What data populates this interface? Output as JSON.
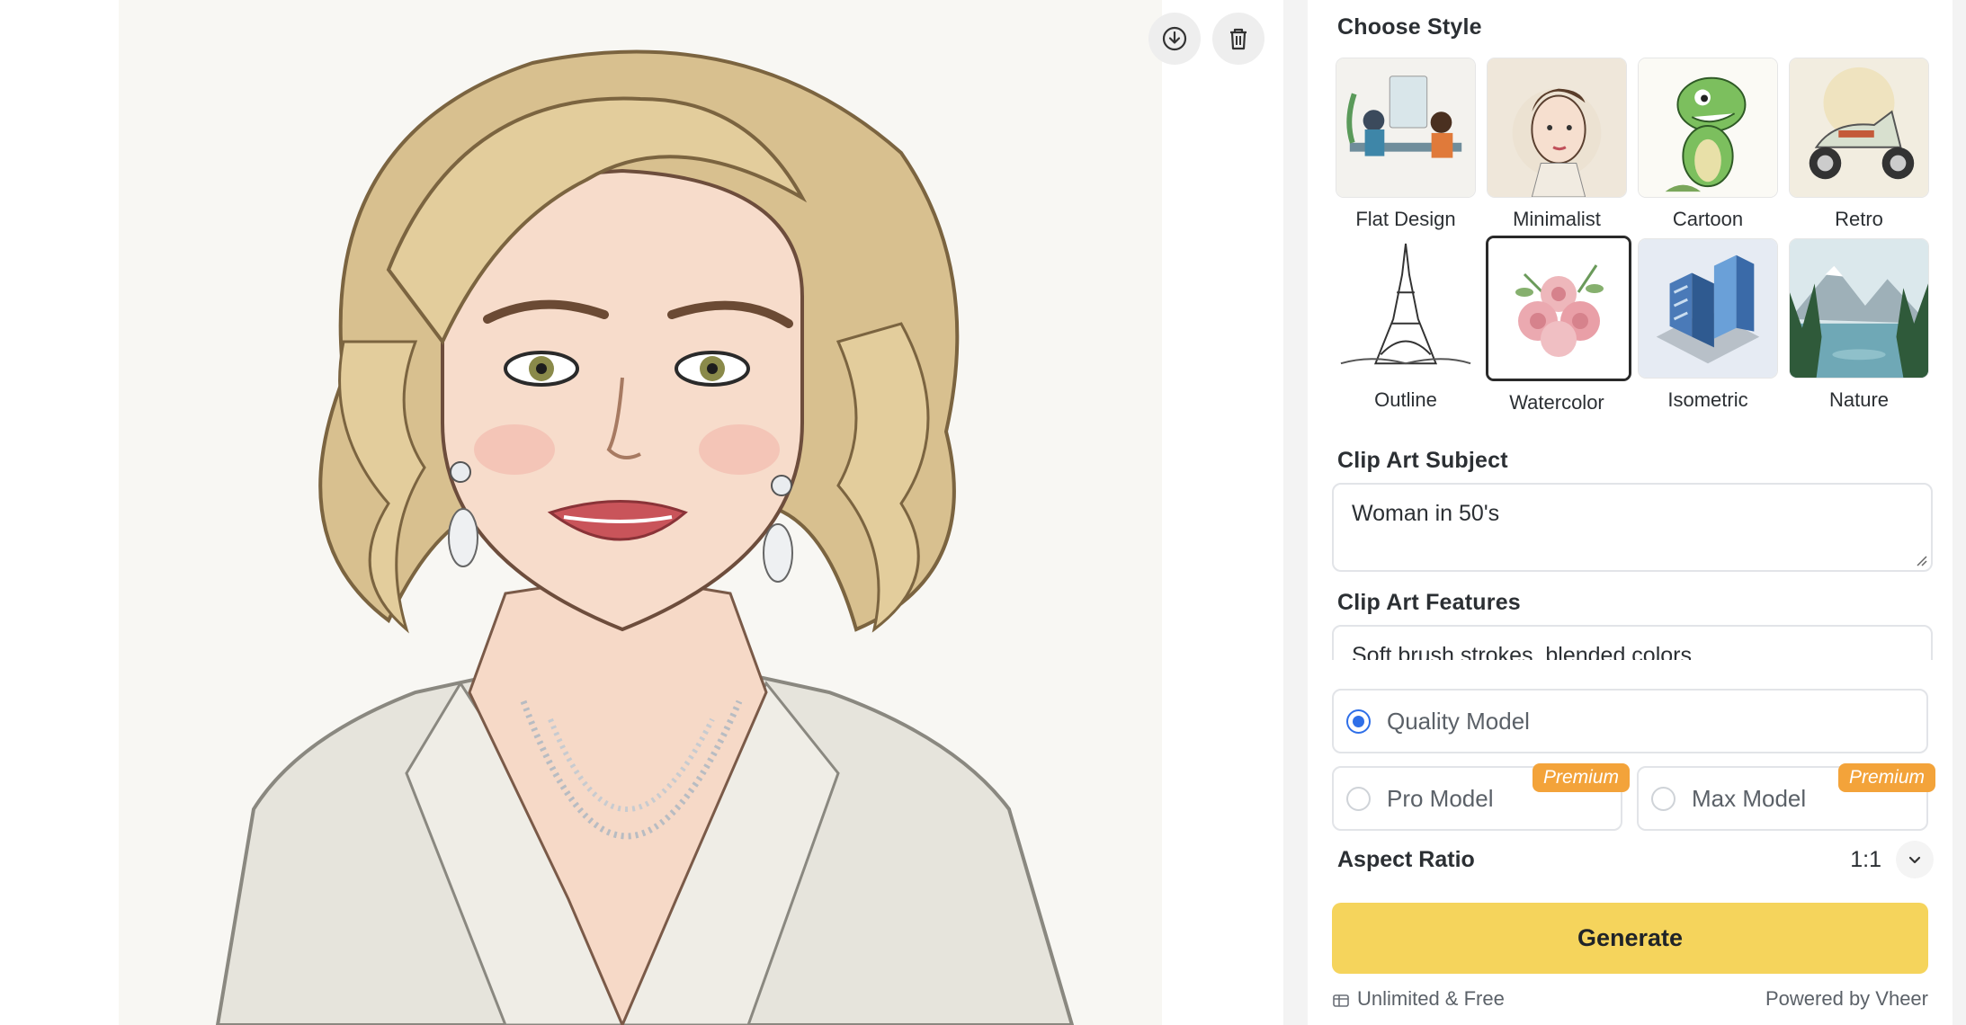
{
  "image_actions": {
    "download_icon": "download-icon",
    "delete_icon": "trash-icon"
  },
  "choose_style": {
    "title": "Choose Style",
    "selected": "Watercolor",
    "styles": [
      {
        "label": "Flat Design"
      },
      {
        "label": "Minimalist"
      },
      {
        "label": "Cartoon"
      },
      {
        "label": "Retro"
      },
      {
        "label": "Outline"
      },
      {
        "label": "Watercolor"
      },
      {
        "label": "Isometric"
      },
      {
        "label": "Nature"
      }
    ]
  },
  "subject": {
    "title": "Clip Art Subject",
    "value": "Woman in 50's"
  },
  "features": {
    "title": "Clip Art Features",
    "value": "Soft brush strokes, blended colors"
  },
  "models": {
    "quality": {
      "label": "Quality Model",
      "selected": true
    },
    "pro": {
      "label": "Pro Model",
      "badge": "Premium",
      "selected": false
    },
    "max": {
      "label": "Max Model",
      "badge": "Premium",
      "selected": false
    }
  },
  "aspect": {
    "label": "Aspect Ratio",
    "value": "1:1"
  },
  "generate_label": "Generate",
  "footer": {
    "left": "Unlimited & Free",
    "right": "Powered by Vheer"
  },
  "colors": {
    "accent_generate": "#f5d45c",
    "premium_badge": "#f3a33a",
    "radio_selected": "#2f6fe8"
  }
}
